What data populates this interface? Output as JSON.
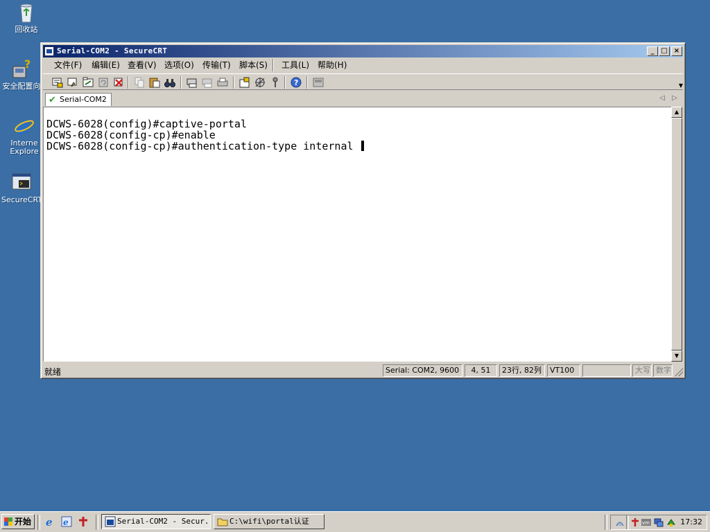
{
  "desktop": {
    "icons": [
      {
        "label": "回收站",
        "icon": "recycle-bin-icon"
      },
      {
        "label": "安全配置向",
        "icon": "security-wizard-icon"
      },
      {
        "label": "Interne Explore",
        "icon": "internet-explorer-icon"
      },
      {
        "label": "SecureCRT",
        "icon": "securecrt-icon"
      }
    ]
  },
  "window": {
    "title": "Serial-COM2 - SecureCRT",
    "menu": [
      "文件(F)",
      "编辑(E)",
      "查看(V)",
      "选项(O)",
      "传输(T)",
      "脚本(S)",
      "工具(L)",
      "帮助(H)"
    ],
    "toolbar_icons": [
      "connect-icon",
      "quick-connect-icon",
      "connect-tab-icon",
      "reconnect-icon",
      "disconnect-icon",
      "copy-icon",
      "paste-icon",
      "find-icon",
      "print-screen-icon",
      "print-selection-icon",
      "print-icon",
      "session-options-icon",
      "global-options-icon",
      "keymap-icon",
      "help-icon",
      "sftp-icon"
    ],
    "tab": {
      "label": "Serial-COM2"
    },
    "terminal_lines": [
      "DCWS-6028(config)#captive-portal",
      "DCWS-6028(config-cp)#enable",
      "DCWS-6028(config-cp)#authentication-type internal "
    ],
    "status": {
      "main": "就绪",
      "connection": "Serial: COM2, 9600",
      "cursor_pos": "4, 51",
      "size": "23行, 82列",
      "emulation": "VT100",
      "blank": "",
      "caps": "大写",
      "num": "数字"
    }
  },
  "taskbar": {
    "start_label": "开始",
    "tasks": [
      {
        "label": "Serial-COM2 - Secur...",
        "active": true
      },
      {
        "label": "C:\\wifi\\portal认证",
        "active": false
      }
    ],
    "clock": "17:32"
  },
  "colors": {
    "desktop": "#3a6ea5",
    "titlebar_start": "#0a246a",
    "titlebar_end": "#a6caf0",
    "chrome": "#d4d0c8"
  }
}
